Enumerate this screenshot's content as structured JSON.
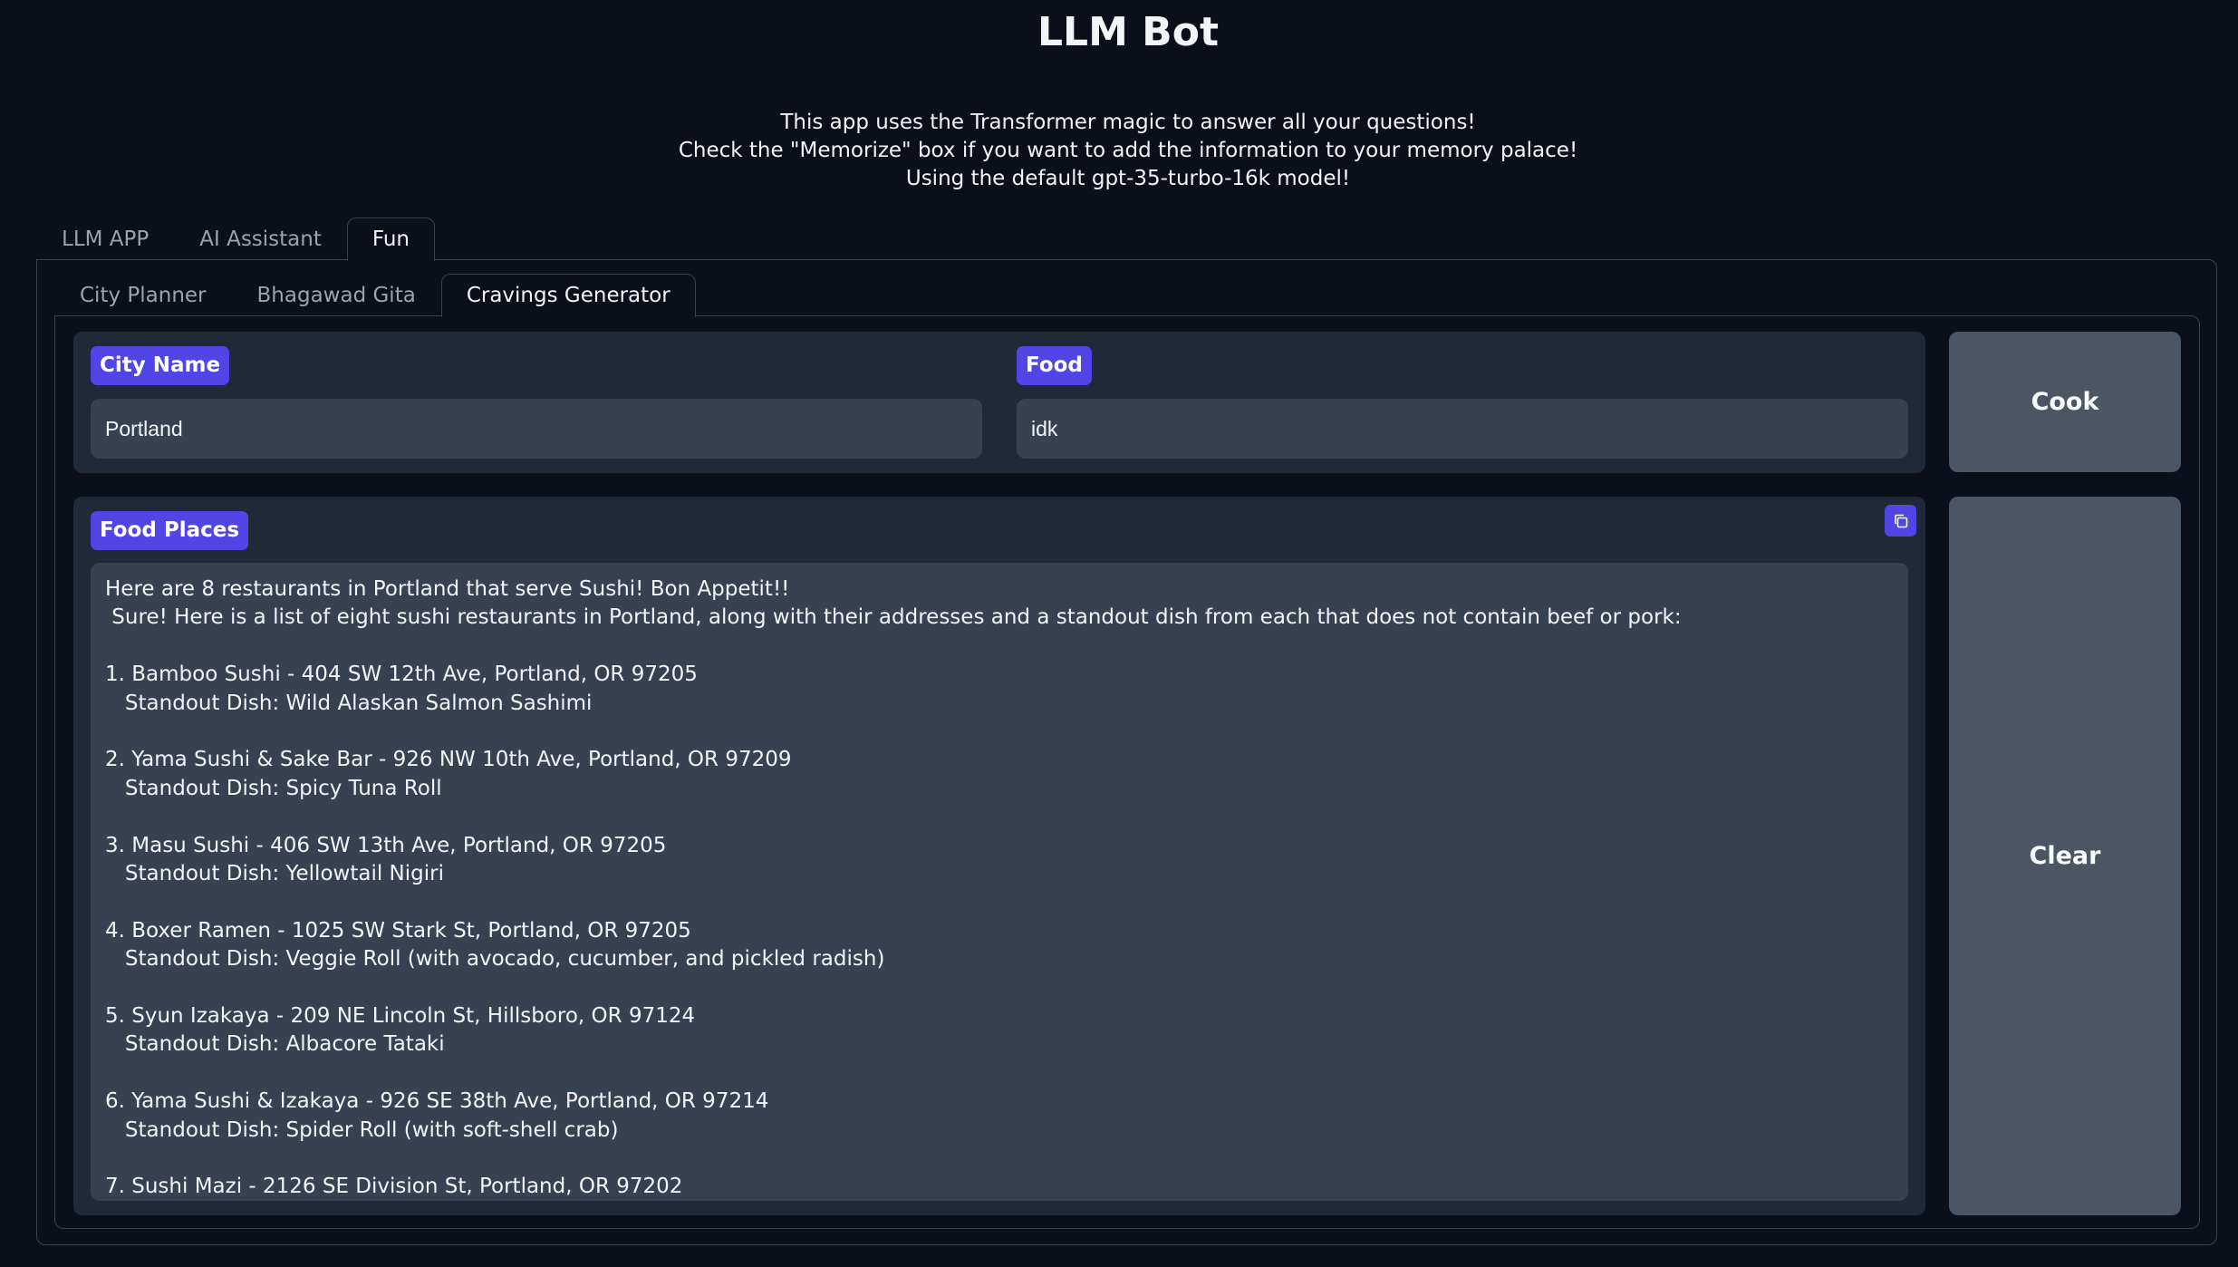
{
  "app": {
    "title": "LLM Bot",
    "description": [
      "This app uses the Transformer magic to answer all your questions!",
      "Check the \"Memorize\" box if you want to add the information to your memory palace!",
      "Using the default gpt-35-turbo-16k model!"
    ]
  },
  "outer_tabs": [
    {
      "label": "LLM APP",
      "active": false
    },
    {
      "label": "AI Assistant",
      "active": false
    },
    {
      "label": "Fun",
      "active": true
    }
  ],
  "inner_tabs": [
    {
      "label": "City Planner",
      "active": false
    },
    {
      "label": "Bhagawad Gita",
      "active": false
    },
    {
      "label": "Cravings Generator",
      "active": true
    }
  ],
  "form": {
    "city_label": "City Name",
    "city_value": "Portland",
    "food_label": "Food",
    "food_value": "idk",
    "cook_button": "Cook",
    "clear_button": "Clear"
  },
  "output": {
    "label": "Food Places",
    "copy_icon": "copy-icon",
    "lines": [
      "Here are 8 restaurants in Portland that serve Sushi! Bon Appetit!!",
      " Sure! Here is a list of eight sushi restaurants in Portland, along with their addresses and a standout dish from each that does not contain beef or pork:",
      "",
      "1. Bamboo Sushi - 404 SW 12th Ave, Portland, OR 97205",
      "   Standout Dish: Wild Alaskan Salmon Sashimi",
      "",
      "2. Yama Sushi & Sake Bar - 926 NW 10th Ave, Portland, OR 97209",
      "   Standout Dish: Spicy Tuna Roll",
      "",
      "3. Masu Sushi - 406 SW 13th Ave, Portland, OR 97205",
      "   Standout Dish: Yellowtail Nigiri",
      "",
      "4. Boxer Ramen - 1025 SW Stark St, Portland, OR 97205",
      "   Standout Dish: Veggie Roll (with avocado, cucumber, and pickled radish)",
      "",
      "5. Syun Izakaya - 209 NE Lincoln St, Hillsboro, OR 97124",
      "   Standout Dish: Albacore Tataki",
      "",
      "6. Yama Sushi & Izakaya - 926 SE 38th Ave, Portland, OR 97214",
      "   Standout Dish: Spider Roll (with soft-shell crab)",
      "",
      "7. Sushi Mazi - 2126 SE Division St, Portland, OR 97202"
    ]
  },
  "colors": {
    "background": "#0b0f19",
    "accent": "#4f46e5",
    "panel": "#1f2937",
    "field": "#374151",
    "button": "#4b5563"
  }
}
